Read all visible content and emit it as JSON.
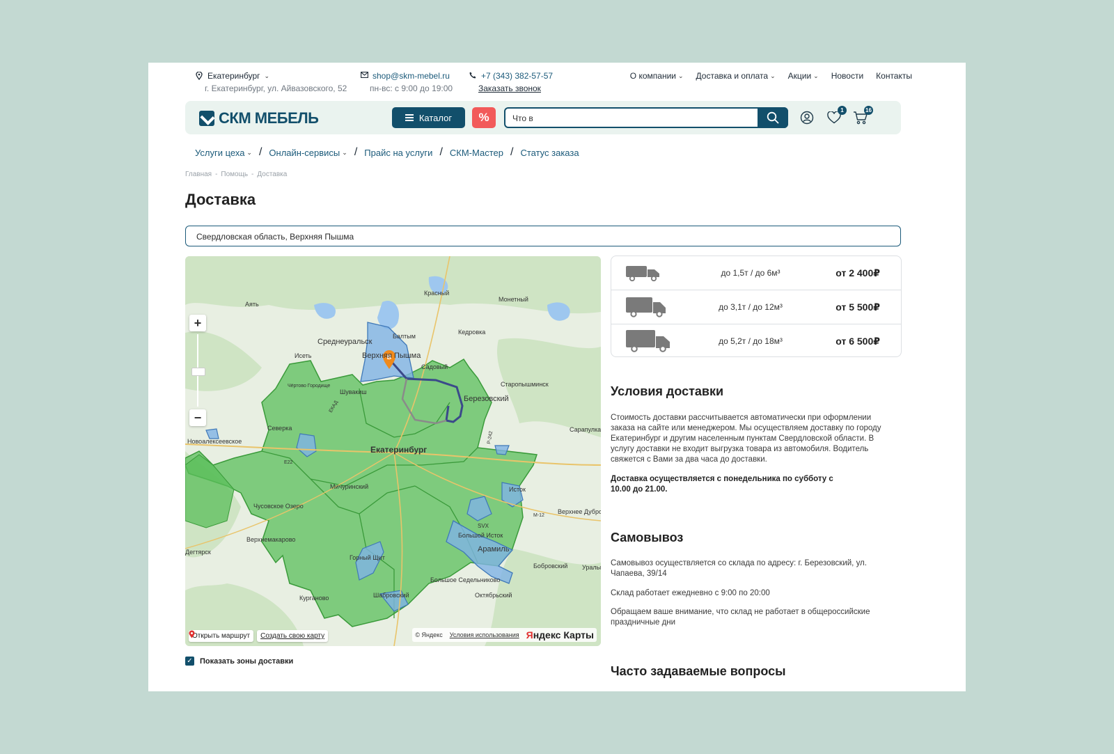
{
  "topbar": {
    "city": "Екатеринбург",
    "address": "г. Екатеринбург, ул. Айвазовского, 52",
    "email": "shop@skm-mebel.ru",
    "hours": "пн-вс: с 9:00 до 19:00",
    "phone": "+7 (343) 382-57-57",
    "callback": "Заказать звонок",
    "nav": [
      {
        "label": "О компании",
        "dropdown": true
      },
      {
        "label": "Доставка и оплата",
        "dropdown": true
      },
      {
        "label": "Акции",
        "dropdown": true
      },
      {
        "label": "Новости",
        "dropdown": false
      },
      {
        "label": "Контакты",
        "dropdown": false
      }
    ]
  },
  "header": {
    "logo": "СКМ МЕБЕЛЬ",
    "catalog_label": "Каталог",
    "sale_label": "%",
    "search_value": "Что в",
    "wishlist_count": "1",
    "cart_count": "16"
  },
  "service_nav": [
    {
      "label": "Услуги цеха",
      "dropdown": true
    },
    {
      "label": "Онлайн-сервисы",
      "dropdown": true
    },
    {
      "label": "Прайс на услуги",
      "dropdown": false
    },
    {
      "label": "СКМ-Мастер",
      "dropdown": false
    },
    {
      "label": "Статус заказа",
      "dropdown": false
    }
  ],
  "breadcrumb": [
    "Главная",
    "Помощь",
    "Доставка"
  ],
  "page_title": "Доставка",
  "address_value": "Свердловская область, Верхняя Пышма",
  "map": {
    "labels": [
      "Красный",
      "Аять",
      "Монетный",
      "Балтым",
      "Кедровка",
      "Среднеуральск",
      "Верхняя Пышма",
      "Исеть",
      "Садовый",
      "Старопышминск",
      "Березовский",
      "Шувакиш",
      "Чёртово Городище",
      "Сарапулка",
      "Новоалексеевское",
      "Северка",
      "Екатеринбург",
      "Мичуринский",
      "Исток",
      "Чусовское Озеро",
      "Верхнее Дуброво",
      "Верхнемакарово",
      "Большой Исток",
      "Арамиль",
      "Горный Щит",
      "Бобровский",
      "Уральский",
      "Большое Седельниково",
      "Октябрьский",
      "Курганово",
      "Шабровский",
      "ЕКАД",
      "SVX",
      "Е22",
      "М-12",
      "Р-242",
      "Дегтярск"
    ],
    "route_label": "Открыть маршрут",
    "create_label": "Создать свою карту",
    "copyright": "© Яндекс",
    "terms": "Условия использования",
    "brand_a": "Я",
    "brand_b": "ндекс Карты",
    "marker": "B",
    "colors": {
      "zone_green": "#5bbf5b",
      "zone_blue": "#7fb3e6",
      "route": "#3b4a8a"
    }
  },
  "show_zones_label": "Показать зоны доставки",
  "tariffs": [
    {
      "limit": "до 1,5т / до 6м³",
      "price": "от 2 400₽"
    },
    {
      "limit": "до 3,1т / до 12м³",
      "price": "от 5 500₽"
    },
    {
      "limit": "до 5,2т / до 18м³",
      "price": "от 6 500₽"
    }
  ],
  "conditions": {
    "title": "Условия доставки",
    "text": "Стоимость доставки рассчитывается автоматически при оформлении заказа на сайте или менеджером. Мы осуществляем доставку по городу Екатеринбург и другим населенным пунктам Свердловской области. В услугу доставки не входит выгрузка товара из автомобиля. Водитель свяжется с Вами за два часа до доставки.",
    "schedule": "Доставка осуществляется с понедельника по субботу с 10.00 до 21.00."
  },
  "pickup": {
    "title": "Самовывоз",
    "address": "Самовывоз осуществляется со склада по адресу: г. Березовский, ул. Чапаева, 39/14",
    "hours": "Склад работает ежедневно с 9:00 по 20:00",
    "note": "Обращаем ваше внимание, что склад не работает в общероссийские праздничные дни"
  },
  "faq_title": "Часто задаваемые вопросы"
}
